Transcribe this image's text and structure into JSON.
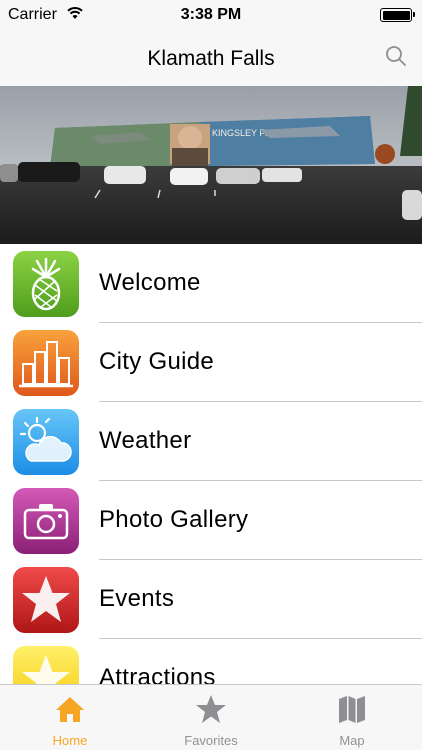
{
  "status_bar": {
    "carrier": "Carrier",
    "time": "3:38 PM"
  },
  "nav": {
    "title": "Klamath Falls",
    "search_icon": "search-icon"
  },
  "hero": {
    "mural_text": "KINGSLEY FIELD",
    "description_icon": "photo"
  },
  "menu": {
    "items": [
      {
        "label": "Welcome",
        "icon": "pinecone-icon",
        "color": "#6fbf2e"
      },
      {
        "label": "City Guide",
        "icon": "city-buildings-icon",
        "color": "#ee7b26"
      },
      {
        "label": "Weather",
        "icon": "weather-cloud-sun-icon",
        "color": "#3aa8f0"
      },
      {
        "label": "Photo Gallery",
        "icon": "camera-icon",
        "color": "#b03c98"
      },
      {
        "label": "Events",
        "icon": "star-icon",
        "color": "#d82c2c"
      },
      {
        "label": "Attractions",
        "icon": "star-icon",
        "color": "#f8da2a"
      }
    ]
  },
  "tabs": [
    {
      "label": "Home",
      "icon": "home-icon",
      "active": true
    },
    {
      "label": "Favorites",
      "icon": "star-icon",
      "active": false
    },
    {
      "label": "Map",
      "icon": "map-icon",
      "active": false
    }
  ],
  "colors": {
    "accent": "#f5a623",
    "inactive": "#929292"
  }
}
